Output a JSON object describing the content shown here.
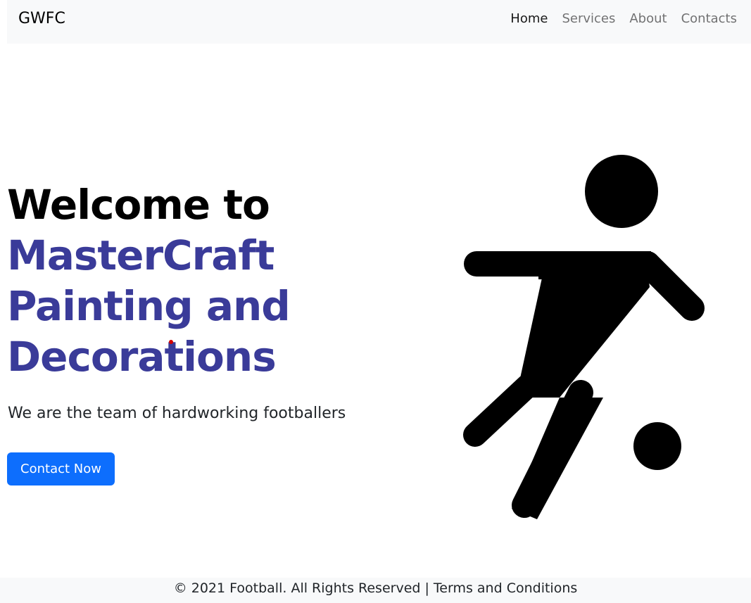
{
  "navbar": {
    "brand": "GWFC",
    "links": [
      {
        "label": "Home",
        "active": true
      },
      {
        "label": "Services",
        "active": false
      },
      {
        "label": "About",
        "active": false
      },
      {
        "label": "Contacts",
        "active": false
      }
    ]
  },
  "hero": {
    "title_line1": "Welcome to",
    "title_accent_lines": [
      "MasterCraft",
      "Painting and",
      "Decorations"
    ],
    "subtitle": "We are the team of hardworking footballers",
    "cta_label": "Contact Now",
    "illustration_icon": "soccer-player-kicking-ball-icon"
  },
  "footer": {
    "text": "© 2021 Football. All Rights Reserved | Terms and Conditions"
  },
  "colors": {
    "accent_title": "#3a3b99",
    "button": "#0d6efd",
    "navbar_bg": "#f8f9fa",
    "footer_bg": "#f8f9fa"
  }
}
